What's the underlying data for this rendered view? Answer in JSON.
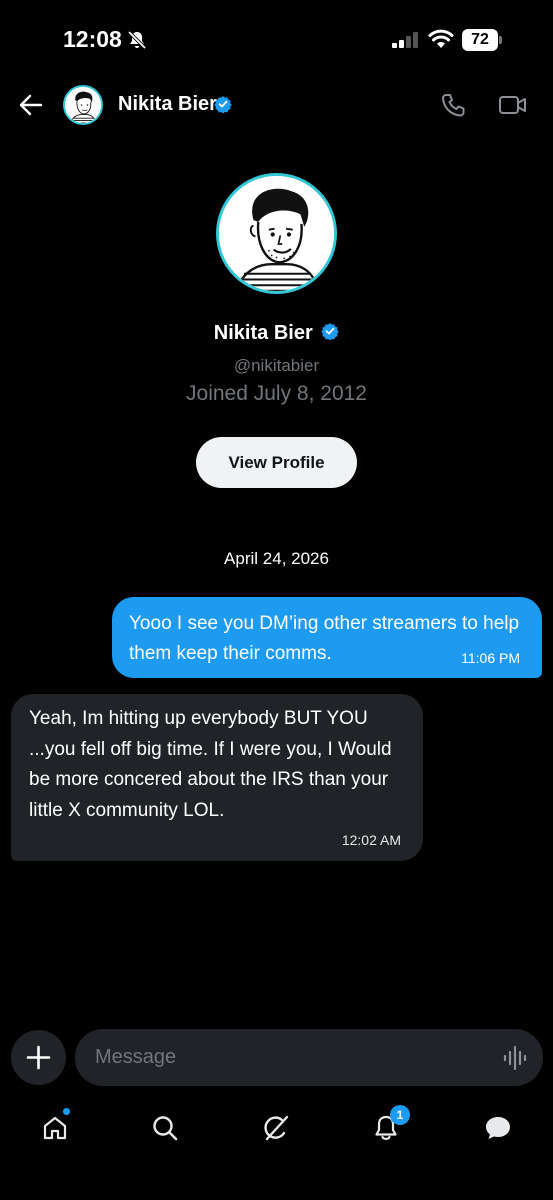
{
  "status_bar": {
    "time": "12:08",
    "battery": "72",
    "icons": [
      "bell-off-icon",
      "signal-icon",
      "wifi-icon",
      "battery-icon"
    ]
  },
  "header": {
    "name": "Nikita Bier",
    "verified": true,
    "icons": [
      "back-arrow-icon",
      "phone-icon",
      "video-icon"
    ]
  },
  "profile": {
    "name": "Nikita Bier",
    "handle": "@nikitabier",
    "joined": "Joined July 8, 2012",
    "view_profile_label": "View Profile"
  },
  "conversation": {
    "date": "April 24, 2026",
    "messages": [
      {
        "direction": "outgoing",
        "text": "Yooo I see you DM’ing other streamers to help them keep their comms.",
        "time": "11:06 PM"
      },
      {
        "direction": "incoming",
        "text": "Yeah, Im hitting up everybody BUT YOU ...you fell off big time. If I were you, I Would be more concered about the IRS than your little X community LOL.",
        "time": "12:02 AM"
      }
    ]
  },
  "composer": {
    "placeholder": "Message"
  },
  "tab_bar": {
    "items": [
      {
        "icon": "home-icon",
        "indicator_dot": true
      },
      {
        "icon": "search-icon"
      },
      {
        "icon": "grok-icon"
      },
      {
        "icon": "bell-icon",
        "badge": "1"
      },
      {
        "icon": "messages-icon",
        "active": true
      }
    ]
  },
  "colors": {
    "background": "#000000",
    "accent": "#1d9bf0",
    "incoming_bubble": "#202327",
    "muted_text": "#71767b",
    "avatar_ring": "#33c7d6"
  }
}
